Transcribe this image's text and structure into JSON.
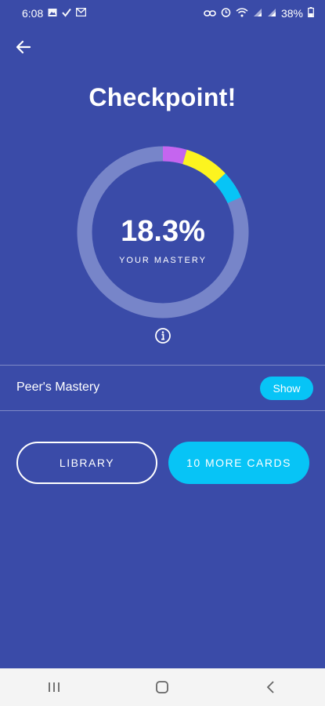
{
  "status_bar": {
    "time": "6:08",
    "left_icons": [
      "image-icon",
      "check-icon",
      "gmail-icon"
    ],
    "right_icons": [
      "link-icon",
      "alarm-icon",
      "wifi-icon",
      "signal-icon",
      "signal-icon"
    ],
    "battery": "38%"
  },
  "header": {
    "back_icon": "arrow-left-icon",
    "title": "Checkpoint!"
  },
  "mastery": {
    "percent_text": "18.3%",
    "label": "YOUR MASTERY",
    "value": 0.183,
    "ring_segments": [
      {
        "color": "#c565ef",
        "fraction": 0.045
      },
      {
        "color": "#fcf41f",
        "fraction": 0.085
      },
      {
        "color": "#07c4f6",
        "fraction": 0.053
      }
    ],
    "track_color": "#7785c9",
    "info_icon": "info-icon"
  },
  "peer": {
    "label": "Peer's Mastery",
    "button_label": "Show"
  },
  "actions": {
    "library_label": "LIBRARY",
    "more_cards_label": "10 MORE CARDS"
  },
  "nav_bar": {
    "icons": [
      "recent-apps-icon",
      "home-icon",
      "back-icon"
    ]
  },
  "colors": {
    "background": "#3a4ba8",
    "accent": "#07c4f6"
  }
}
